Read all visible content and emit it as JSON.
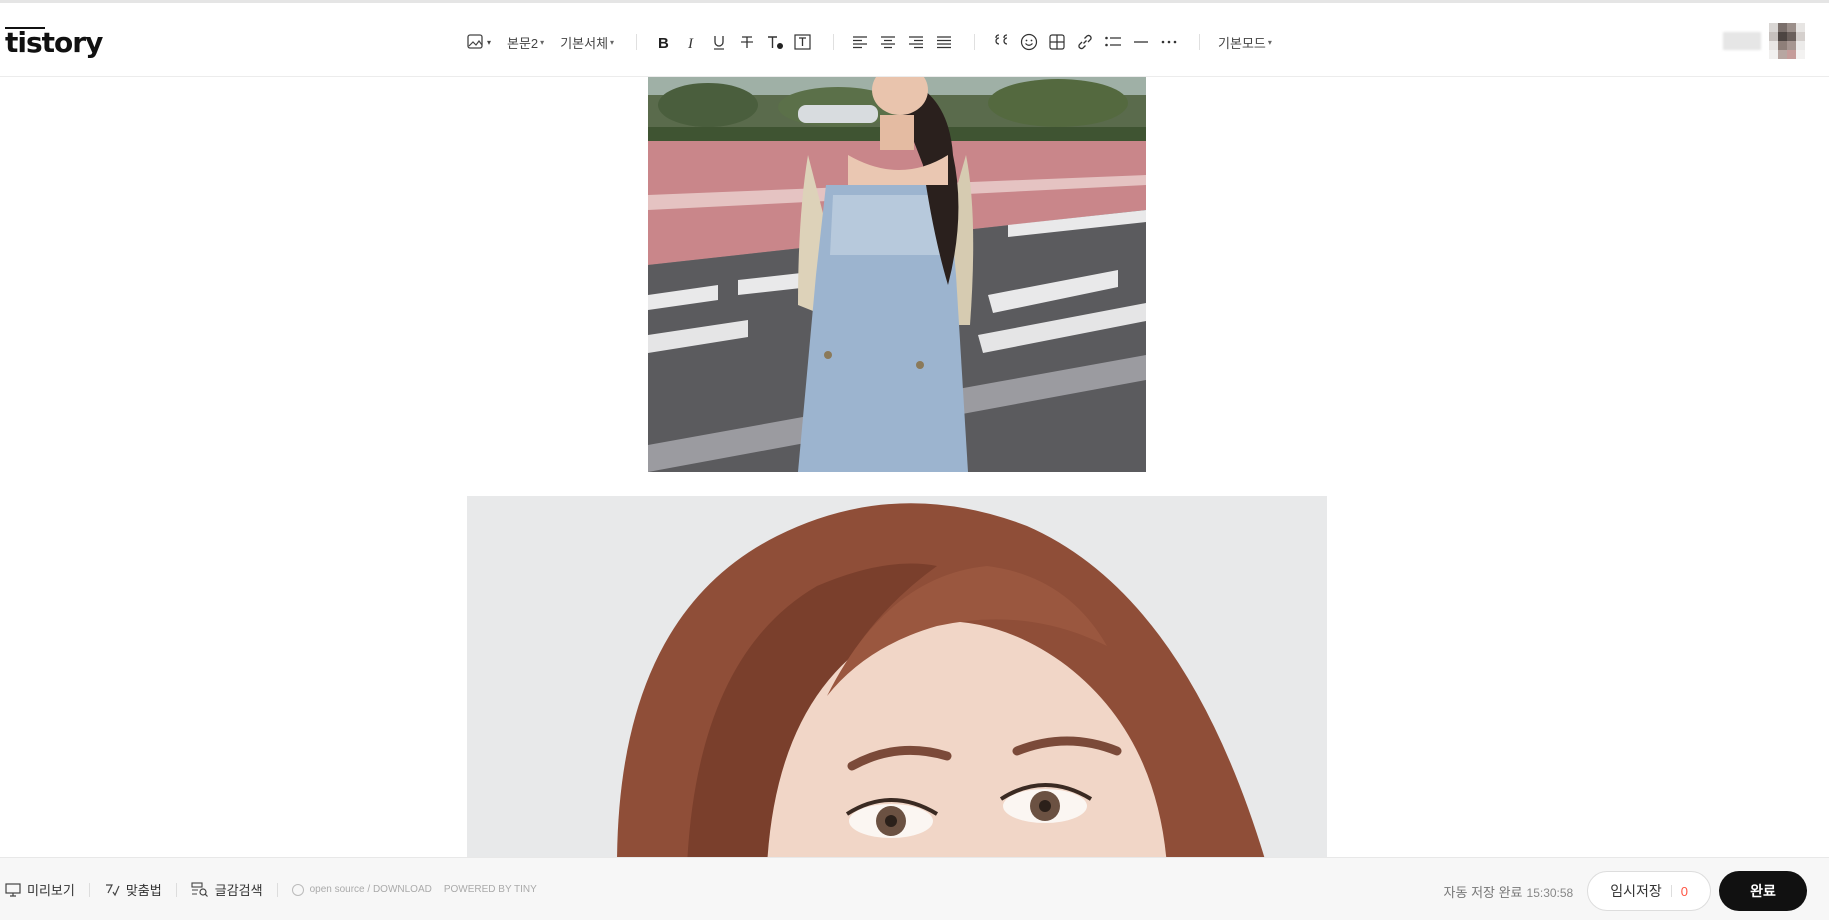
{
  "app": {
    "logo": "tistory"
  },
  "toolbar": {
    "paragraph_style": "본문2",
    "font_family": "기본서체",
    "mode": "기본모드"
  },
  "footer": {
    "preview_label": "미리보기",
    "spellcheck_label": "맞춤법",
    "search_label": "글감검색",
    "opensource_label": "open source / DOWNLOAD",
    "powered_label": "POWERED BY TINY",
    "autosave_text": "자동 저장 완료",
    "autosave_time": "15:30:58",
    "draft_label": "임시저장",
    "draft_count": "0",
    "done_label": "완료"
  },
  "colors": {
    "draft_count": "#ff5544",
    "done_button": "#111111"
  }
}
